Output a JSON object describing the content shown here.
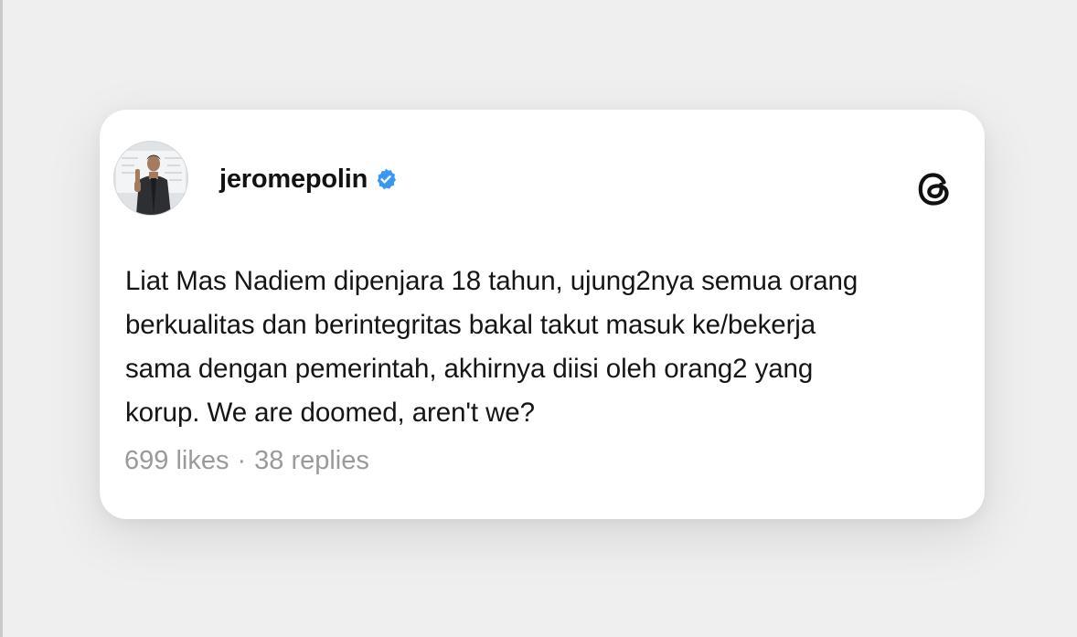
{
  "post": {
    "username": "jeromepolin",
    "verified_icon": "verified-badge-icon",
    "app_logo_icon": "threads-logo-icon",
    "text_lines": [
      "Liat Mas Nadiem dipenjara 18 tahun, ujung2nya semua orang",
      "berkualitas dan berintegritas bakal takut masuk ke/bekerja",
      "sama dengan pemerintah, akhirnya diisi oleh orang2 yang",
      "korup. We are doomed, aren't we?"
    ],
    "likes": "699 likes",
    "separator": "·",
    "replies": "38 replies"
  },
  "colors": {
    "background": "#efefef",
    "card": "#ffffff",
    "text": "#151515",
    "muted": "#9a9a9a",
    "verified_blue": "#3897f0"
  }
}
